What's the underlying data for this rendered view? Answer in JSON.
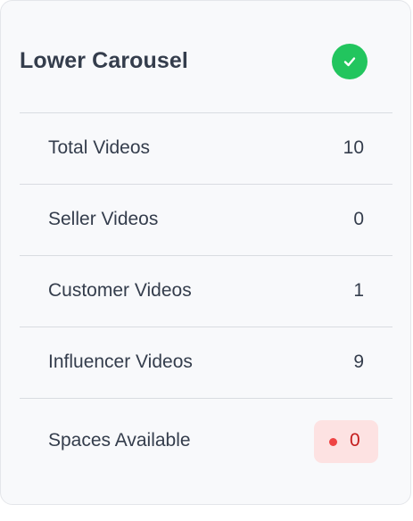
{
  "card": {
    "title": "Lower Carousel",
    "status_icon": "check-circle-icon",
    "status_color": "#22c55e"
  },
  "rows": [
    {
      "label": "Total Videos",
      "value": "10"
    },
    {
      "label": "Seller Videos",
      "value": "0"
    },
    {
      "label": "Customer Videos",
      "value": "1"
    },
    {
      "label": "Influencer Videos",
      "value": "9"
    }
  ],
  "spaces": {
    "label": "Spaces Available",
    "value": "0",
    "badge_color": "#fde2e2",
    "dot_color": "#ef4444"
  }
}
